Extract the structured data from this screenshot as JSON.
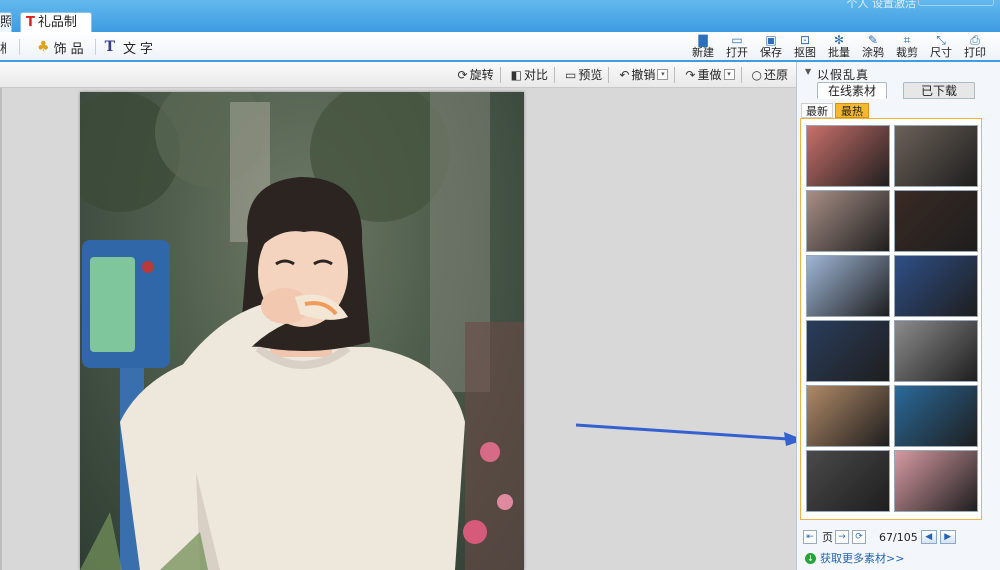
{
  "titlebar": {
    "tab_partial": "照",
    "tab_active": "礼品制作",
    "right_text": "个人 设置激活"
  },
  "toolbar": {
    "left_partial": "框",
    "decor_label": "饰品",
    "text_label": "文字",
    "buttons": [
      {
        "label": "新建",
        "icon": "new-file-icon",
        "glyph": "▇"
      },
      {
        "label": "打开",
        "icon": "open-folder-icon",
        "glyph": "▭"
      },
      {
        "label": "保存",
        "icon": "save-icon",
        "glyph": "▣"
      },
      {
        "label": "抠图",
        "icon": "cutout-icon",
        "glyph": "⊡"
      },
      {
        "label": "批量",
        "icon": "batch-gear-icon",
        "glyph": "✻"
      },
      {
        "label": "涂鸦",
        "icon": "doodle-icon",
        "glyph": "✎"
      },
      {
        "label": "裁剪",
        "icon": "crop-icon",
        "glyph": "⌗"
      },
      {
        "label": "尺寸",
        "icon": "resize-icon",
        "glyph": "⤡"
      },
      {
        "label": "打印",
        "icon": "print-icon",
        "glyph": "⎙"
      }
    ]
  },
  "subtoolbar": {
    "rotate": "旋转",
    "compare": "对比",
    "preview": "预览",
    "undo": "撤销",
    "redo": "重做",
    "restore": "还原"
  },
  "panel": {
    "header": "以假乱真",
    "tab_online": "在线素材",
    "tab_downloaded": "已下载",
    "subtab_newest": "最新",
    "subtab_hot": "最热",
    "pager_label": "页",
    "pager_count": "67/105",
    "more_link": "获取更多素材>>",
    "thumb_colors": [
      "#c9706a",
      "#6b6158",
      "#a88f86",
      "#3a2a24",
      "#9fb6d6",
      "#2e4f86",
      "#2a3d5c",
      "#8c8c8c",
      "#b08a66",
      "#2a6a9a",
      "#4a4a4a",
      "#d69aa2"
    ]
  },
  "colors": {
    "accent": "#3f9ce0",
    "hot_tab": "#f6b830",
    "arrow": "#3560d0"
  }
}
